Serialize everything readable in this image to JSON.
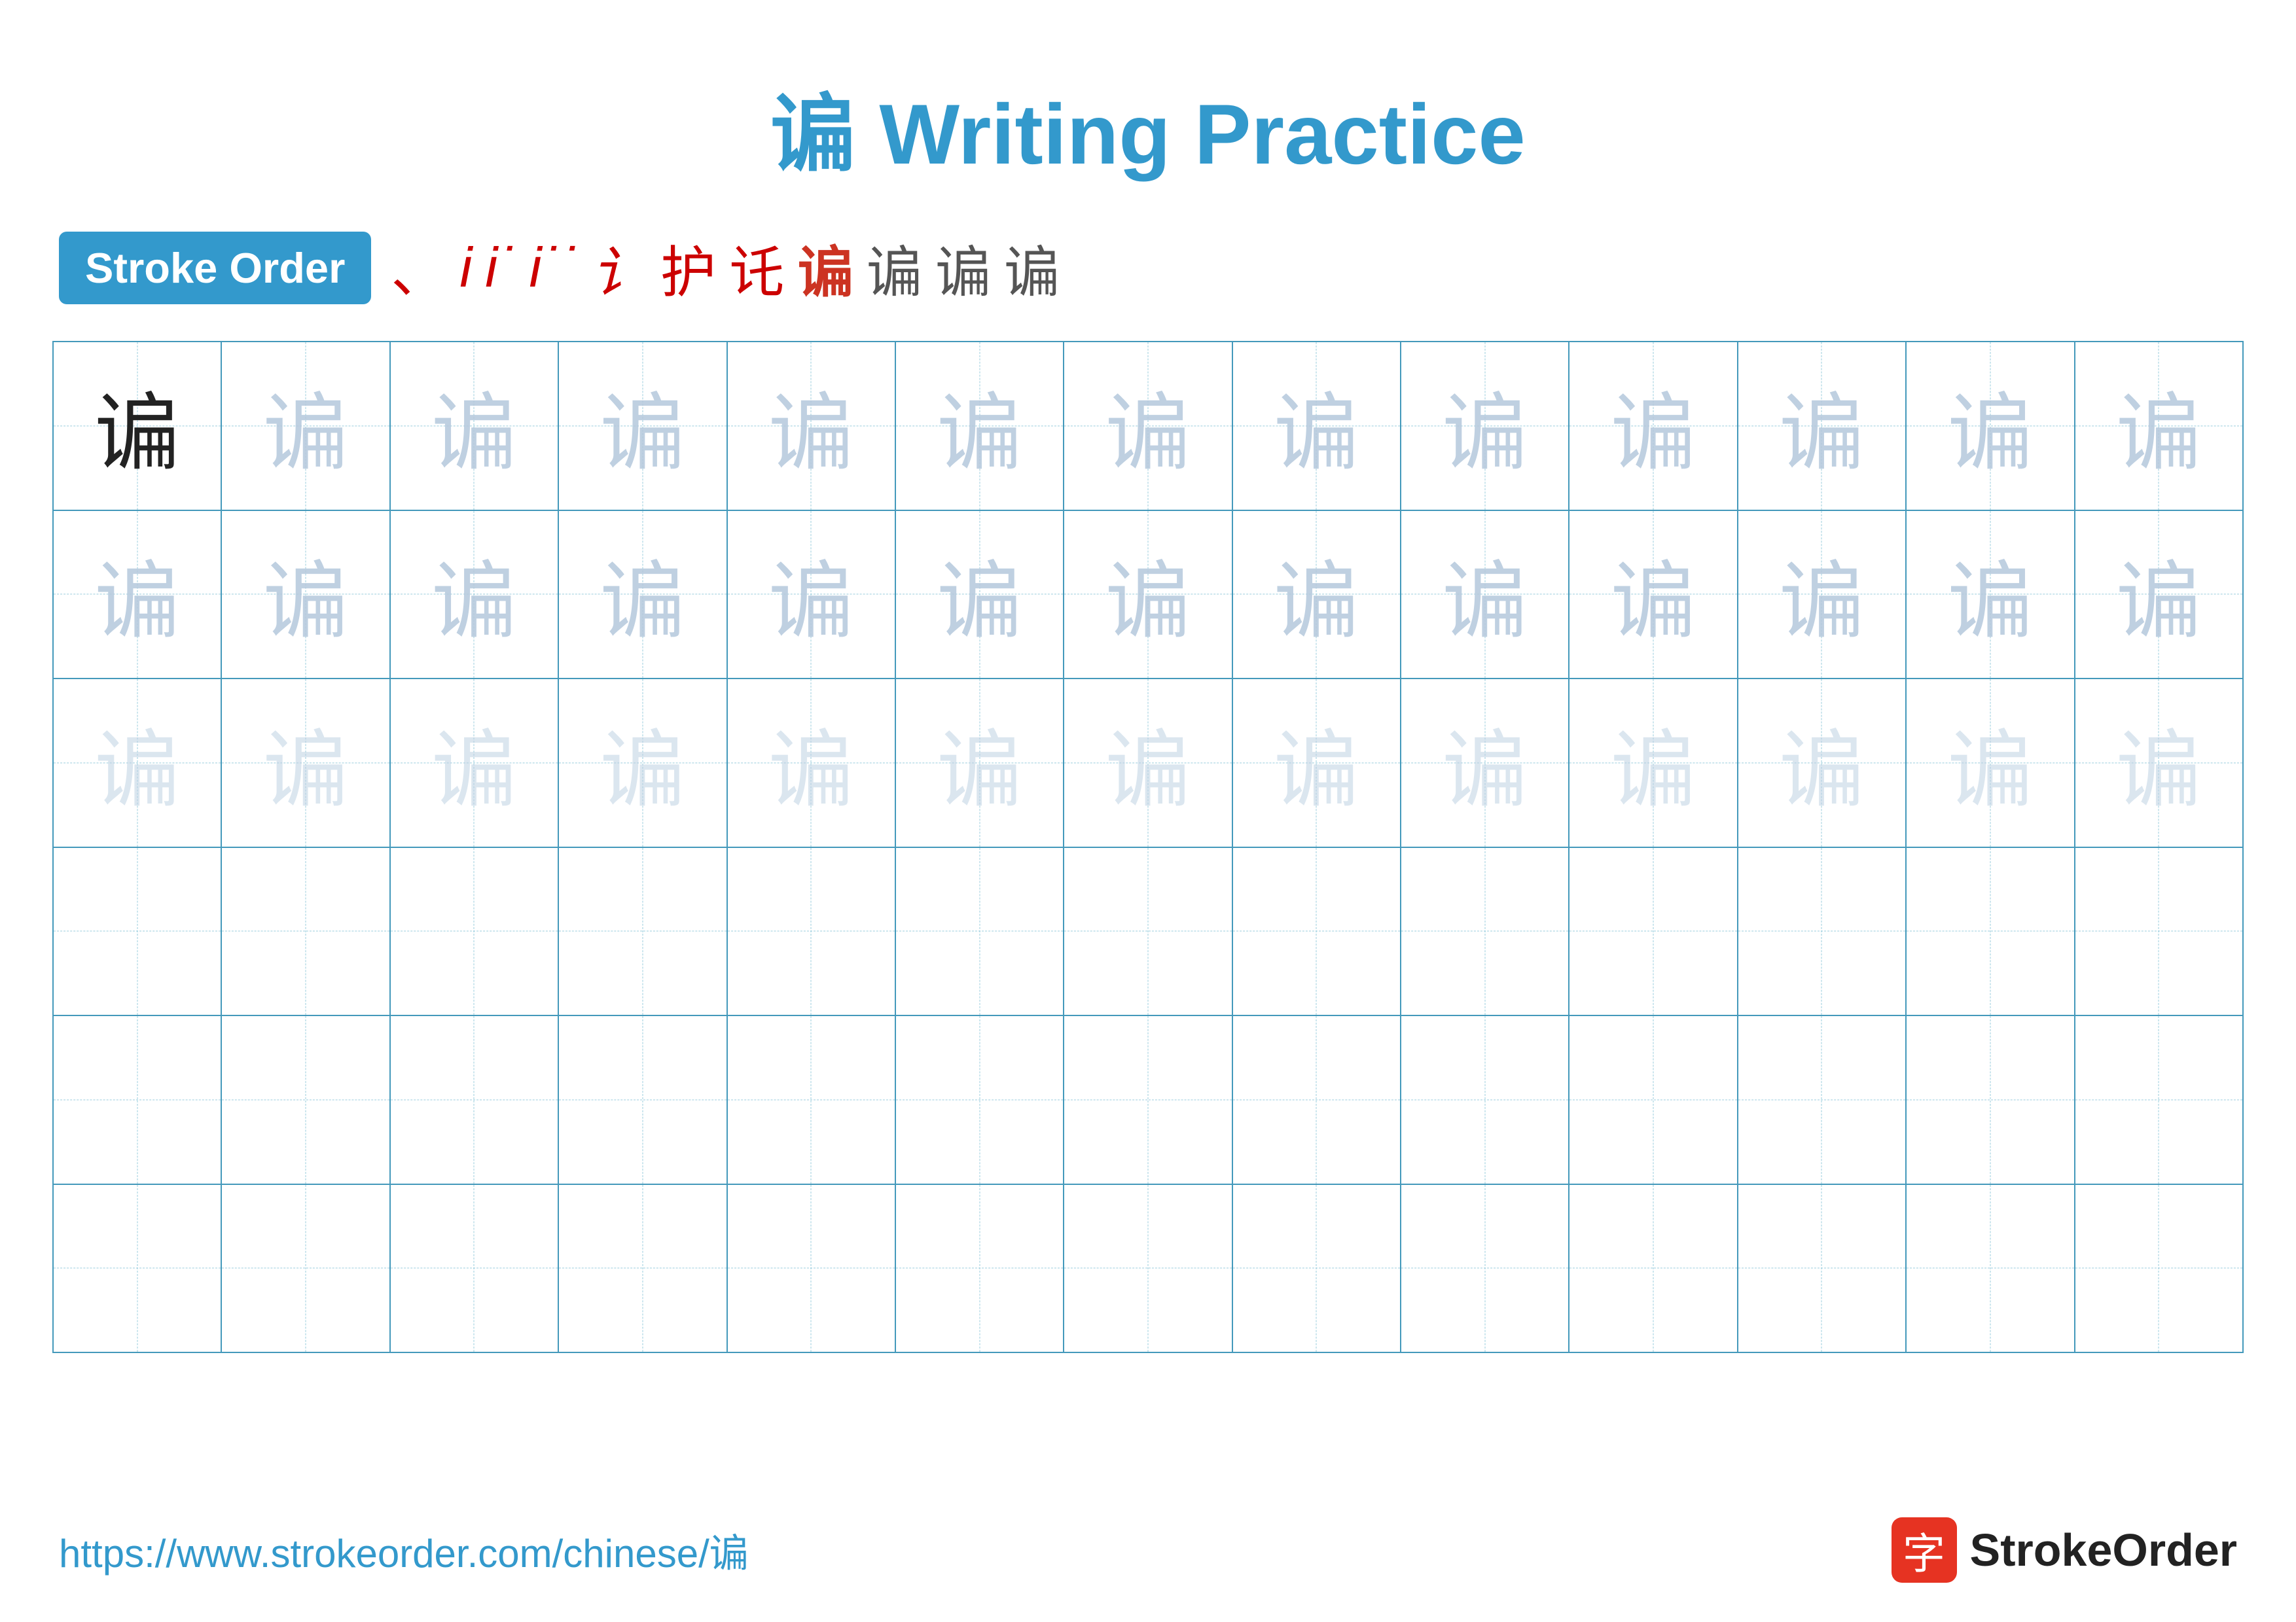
{
  "title": "谝 Writing Practice",
  "stroke_order": {
    "label": "Stroke Order",
    "strokes": [
      "、",
      "㇀",
      "㇀˙",
      "㇀˙˙",
      "㇀˙˙˙",
      "讠˙",
      "讠˙˙",
      "谝˙˙",
      "谝˙",
      "谝",
      "谝"
    ]
  },
  "character": "谝",
  "grid": {
    "rows": 6,
    "cols": 13,
    "row_types": [
      "solid-then-medium",
      "medium",
      "light",
      "empty",
      "empty",
      "empty"
    ]
  },
  "footer": {
    "url": "https://www.strokeorder.com/chinese/谝",
    "logo_char": "字",
    "logo_text": "StrokeOrder"
  }
}
